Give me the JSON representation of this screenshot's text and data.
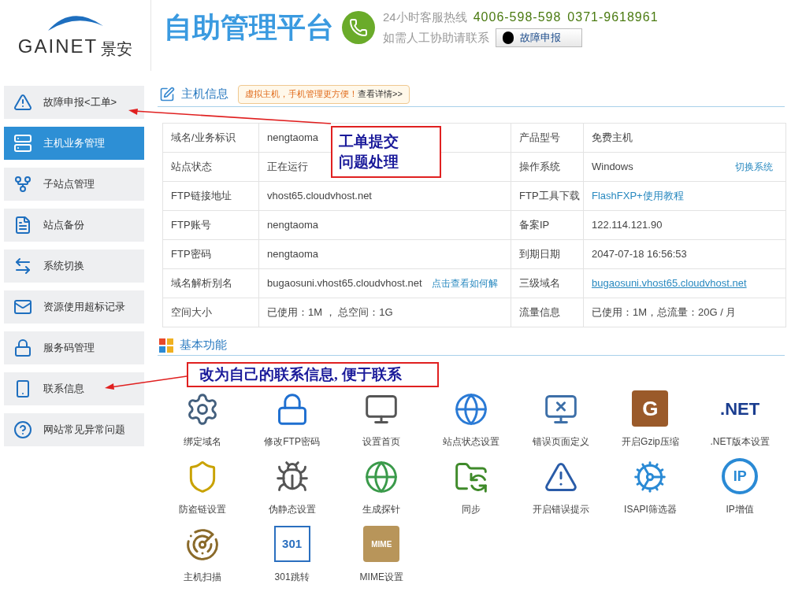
{
  "header": {
    "brand": "GAINET",
    "brand_cn": "景安",
    "title": "自助管理平台",
    "hotline_label": "24小时客服热线",
    "phones": [
      "4006-598-598",
      "0371-9618961"
    ],
    "help_text": "如需人工协助请联系",
    "report_button": "故障申报"
  },
  "sidebar": {
    "items": [
      {
        "label": "故障申报<工单>",
        "selected": false
      },
      {
        "label": "主机业务管理",
        "selected": true
      },
      {
        "label": "子站点管理",
        "selected": false
      },
      {
        "label": "站点备份",
        "selected": false
      },
      {
        "label": "系统切换",
        "selected": false
      },
      {
        "label": "资源使用超标记录",
        "selected": false
      },
      {
        "label": "服务码管理",
        "selected": false
      },
      {
        "label": "联系信息",
        "selected": false
      },
      {
        "label": "网站常见异常问题",
        "selected": false
      }
    ]
  },
  "host_info": {
    "title": "主机信息",
    "promo": "虚拟主机，手机管理更方便！",
    "promo_link": "查看详情>>",
    "rows": [
      [
        {
          "label": "域名/业务标识",
          "value": "nengtaoma",
          "kind": "text"
        },
        {
          "label": "产品型号",
          "value": "免费主机",
          "kind": "text"
        }
      ],
      [
        {
          "label": "站点状态",
          "value": "正在运行",
          "kind": "text"
        },
        {
          "label": "操作系统",
          "value": "Windows",
          "kind": "text",
          "link": "切换系统"
        }
      ],
      [
        {
          "label": "FTP链接地址",
          "value": "vhost65.cloudvhost.net",
          "kind": "text"
        },
        {
          "label": "FTP工具下载",
          "value": "FlashFXP+使用教程",
          "kind": "link"
        }
      ],
      [
        {
          "label": "FTP账号",
          "value": "nengtaoma",
          "kind": "text"
        },
        {
          "label": "备案IP",
          "value": "122.114.121.90",
          "kind": "text"
        }
      ],
      [
        {
          "label": "FTP密码",
          "value": "nengtaoma",
          "kind": "text"
        },
        {
          "label": "到期日期",
          "value": "2047-07-18 16:56:53",
          "kind": "text"
        }
      ],
      [
        {
          "label": "域名解析别名",
          "value": "bugaosuni.vhost65.cloudvhost.net",
          "kind": "text",
          "link": "点击查看如何解"
        },
        {
          "label": "三级域名",
          "value": "bugaosuni.vhost65.cloudvhost.net",
          "kind": "url"
        }
      ],
      [
        {
          "label": "空间大小",
          "value": "已使用：1M ， 总空间：1G",
          "kind": "text"
        },
        {
          "label": "流量信息",
          "value": "已使用：1M，总流量：20G / 月",
          "kind": "text"
        }
      ]
    ]
  },
  "functions": {
    "title": "基本功能",
    "items": [
      {
        "label": "绑定域名"
      },
      {
        "label": "修改FTP密码"
      },
      {
        "label": "设置首页"
      },
      {
        "label": "站点状态设置"
      },
      {
        "label": "错误页面定义"
      },
      {
        "label": "开启Gzip压缩",
        "icon_text": "G"
      },
      {
        "label": ".NET版本设置",
        "icon_text": ".NET"
      },
      {
        "label": "防盗链设置"
      },
      {
        "label": "伪静态设置"
      },
      {
        "label": "生成探针"
      },
      {
        "label": "同步"
      },
      {
        "label": "开启错误提示"
      },
      {
        "label": "ISAPI筛选器"
      },
      {
        "label": "IP增值",
        "icon_text": "IP"
      },
      {
        "label": "主机扫描"
      },
      {
        "label": "301跳转",
        "icon_text": "301"
      },
      {
        "label": "MIME设置",
        "icon_text": "MIME"
      }
    ]
  },
  "annotations": [
    {
      "lines": [
        "工单提交",
        "问题处理"
      ]
    },
    {
      "lines": [
        "改为自己的联系信息, 便于联系"
      ]
    }
  ]
}
